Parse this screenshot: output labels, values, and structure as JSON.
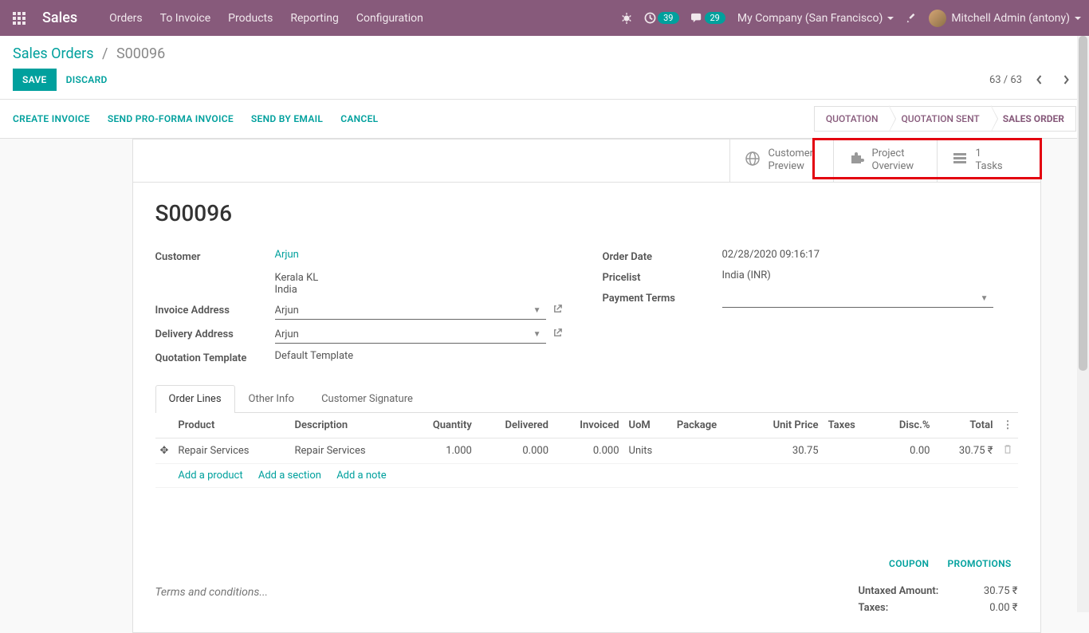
{
  "navbar": {
    "brand": "Sales",
    "links": [
      "Orders",
      "To Invoice",
      "Products",
      "Reporting",
      "Configuration"
    ],
    "badge1": "39",
    "badge2": "29",
    "company": "My Company (San Francisco)",
    "user": "Mitchell Admin (antony)"
  },
  "breadcrumb": {
    "root": "Sales Orders",
    "current": "S00096"
  },
  "buttons": {
    "save": "SAVE",
    "discard": "DISCARD"
  },
  "pager": "63 / 63",
  "actions": {
    "a1": "CREATE INVOICE",
    "a2": "SEND PRO-FORMA INVOICE",
    "a3": "SEND BY EMAIL",
    "a4": "CANCEL"
  },
  "status": {
    "s1": "QUOTATION",
    "s2": "QUOTATION SENT",
    "s3": "SALES ORDER"
  },
  "statbtns": {
    "cp1": "Customer",
    "cp2": "Preview",
    "po1": "Project",
    "po2": "Overview",
    "t1": "1",
    "t2": "Tasks"
  },
  "title": "S00096",
  "fields": {
    "customer_label": "Customer",
    "customer_val": "Arjun",
    "addr1": "Kerala KL",
    "addr2": "India",
    "invaddr_label": "Invoice Address",
    "invaddr_val": "Arjun",
    "deladdr_label": "Delivery Address",
    "deladdr_val": "Arjun",
    "quot_label": "Quotation Template",
    "quot_val": "Default Template",
    "orderdate_label": "Order Date",
    "orderdate_val": "02/28/2020 09:16:17",
    "pricelist_label": "Pricelist",
    "pricelist_val": "India (INR)",
    "payterms_label": "Payment Terms"
  },
  "tabs": {
    "t1": "Order Lines",
    "t2": "Other Info",
    "t3": "Customer Signature"
  },
  "th": {
    "product": "Product",
    "desc": "Description",
    "qty": "Quantity",
    "del": "Delivered",
    "inv": "Invoiced",
    "uom": "UoM",
    "pkg": "Package",
    "unit": "Unit Price",
    "tax": "Taxes",
    "disc": "Disc.%",
    "total": "Total"
  },
  "line": {
    "product": "Repair Services",
    "desc": "Repair Services",
    "qty": "1.000",
    "del": "0.000",
    "inv": "0.000",
    "uom": "Units",
    "unit": "30.75",
    "disc": "0.00",
    "total": "30.75 ₹"
  },
  "addlinks": {
    "prod": "Add a product",
    "sec": "Add a section",
    "note": "Add a note"
  },
  "promo": {
    "coupon": "COUPON",
    "promotions": "PROMOTIONS"
  },
  "terms_placeholder": "Terms and conditions...",
  "totals": {
    "untaxed_l": "Untaxed Amount:",
    "untaxed_v": "30.75 ₹",
    "taxes_l": "Taxes:",
    "taxes_v": "0.00 ₹"
  }
}
